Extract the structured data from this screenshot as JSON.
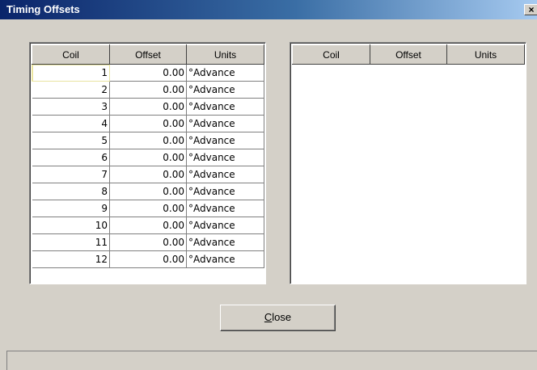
{
  "window": {
    "title": "Timing Offsets",
    "close_glyph": "×"
  },
  "left_grid": {
    "columns": [
      "Coil",
      "Offset",
      "Units"
    ],
    "rows": [
      {
        "coil": "1",
        "offset": "0.00",
        "units": "°Advance"
      },
      {
        "coil": "2",
        "offset": "0.00",
        "units": "°Advance"
      },
      {
        "coil": "3",
        "offset": "0.00",
        "units": "°Advance"
      },
      {
        "coil": "4",
        "offset": "0.00",
        "units": "°Advance"
      },
      {
        "coil": "5",
        "offset": "0.00",
        "units": "°Advance"
      },
      {
        "coil": "6",
        "offset": "0.00",
        "units": "°Advance"
      },
      {
        "coil": "7",
        "offset": "0.00",
        "units": "°Advance"
      },
      {
        "coil": "8",
        "offset": "0.00",
        "units": "°Advance"
      },
      {
        "coil": "9",
        "offset": "0.00",
        "units": "°Advance"
      },
      {
        "coil": "10",
        "offset": "0.00",
        "units": "°Advance"
      },
      {
        "coil": "11",
        "offset": "0.00",
        "units": "°Advance"
      },
      {
        "coil": "12",
        "offset": "0.00",
        "units": "°Advance"
      }
    ]
  },
  "right_grid": {
    "columns": [
      "Coil",
      "Offset",
      "Units"
    ],
    "rows": []
  },
  "buttons": {
    "close_accel": "C",
    "close_rest": "lose"
  },
  "colors": {
    "face": "#d4d0c8",
    "title_start": "#0a246a",
    "title_end": "#a6caf0"
  }
}
